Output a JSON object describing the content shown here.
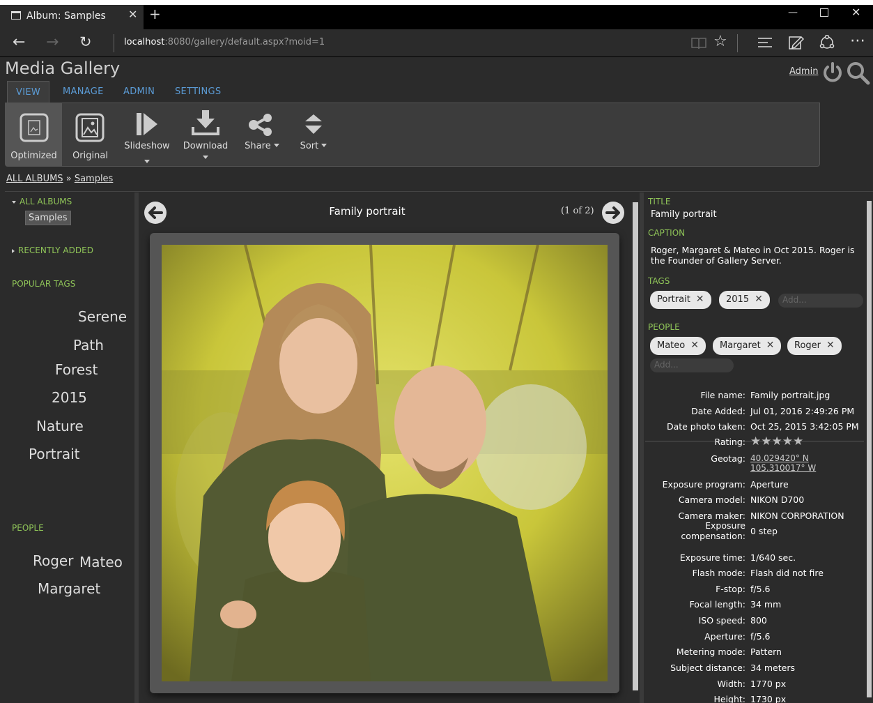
{
  "browser": {
    "tab_title": "Album: Samples",
    "url_host": "localhost",
    "url_rest": ":8080/gallery/default.aspx?moid=1"
  },
  "header": {
    "site_title": "Media Gallery",
    "admin_link": "Admin"
  },
  "tabs": [
    {
      "label": "VIEW"
    },
    {
      "label": "MANAGE"
    },
    {
      "label": "ADMIN"
    },
    {
      "label": "SETTINGS"
    }
  ],
  "toolbar": {
    "items": [
      {
        "label": "Optimized"
      },
      {
        "label": "Original"
      },
      {
        "label": "Slideshow"
      },
      {
        "label": "Download"
      },
      {
        "label": "Share"
      },
      {
        "label": "Sort"
      }
    ]
  },
  "breadcrumb": {
    "root": "ALL ALBUMS",
    "sep": "»",
    "current": "Samples"
  },
  "sidebar": {
    "all_albums": "ALL ALBUMS",
    "album": "Samples",
    "recently_added": "RECENTLY ADDED",
    "popular_tags_header": "POPULAR TAGS",
    "tags": [
      "Serene",
      "Path",
      "Forest",
      "2015",
      "Nature",
      "Portrait"
    ],
    "people_header": "PEOPLE",
    "people": [
      "Roger",
      "Mateo",
      "Margaret"
    ]
  },
  "viewer": {
    "title": "Family portrait",
    "counter": "(1 of 2)"
  },
  "details": {
    "title_label": "TITLE",
    "title_value": "Family portrait",
    "caption_label": "CAPTION",
    "caption_line1": "Roger, Margaret & Mateo in Oct 2015. Roger is",
    "caption_line2": "the Founder of Gallery Server.",
    "tags_label": "TAGS",
    "tags": [
      "Portrait",
      "2015"
    ],
    "tags_add_placeholder": "Add...",
    "people_label": "PEOPLE",
    "people": [
      "Mateo",
      "Margaret",
      "Roger"
    ],
    "people_add_placeholder": "Add...",
    "rating": 5,
    "metadata": [
      {
        "key": "File name:",
        "value": "Family portrait.jpg"
      },
      {
        "key": "Date Added:",
        "value": "Jul 01, 2016 2:49:26 PM"
      },
      {
        "key": "Date photo taken:",
        "value": "Oct 25, 2015 3:42:05 PM"
      },
      {
        "key": "Rating:",
        "value": ""
      },
      {
        "key": "Geotag:",
        "value": "40.029420° N",
        "value2": "105.310017° W"
      },
      {
        "key": "Exposure program:",
        "value": "Aperture"
      },
      {
        "key": "Camera model:",
        "value": "NIKON D700"
      },
      {
        "key": "Camera maker:",
        "value": "NIKON CORPORATION"
      },
      {
        "key": "Exposure",
        "key2": "compensation:",
        "value": "0 step"
      },
      {
        "key": "Exposure time:",
        "value": "1/640 sec."
      },
      {
        "key": "Flash mode:",
        "value": "Flash did not fire"
      },
      {
        "key": "F-stop:",
        "value": "f/5.6"
      },
      {
        "key": "Focal length:",
        "value": "34 mm"
      },
      {
        "key": "ISO speed:",
        "value": "800"
      },
      {
        "key": "Aperture:",
        "value": "f/5.6"
      },
      {
        "key": "Metering mode:",
        "value": "Pattern"
      },
      {
        "key": "Subject distance:",
        "value": "34 meters"
      },
      {
        "key": "Width:",
        "value": "1770 px"
      },
      {
        "key": "Height:",
        "value": "1730 px"
      }
    ]
  }
}
